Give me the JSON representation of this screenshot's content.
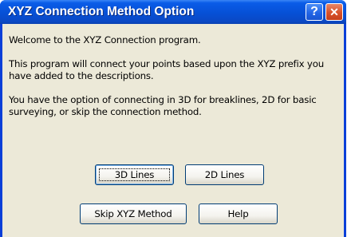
{
  "window": {
    "title": "XYZ Connection Method Option",
    "help_glyph": "?",
    "close_glyph": "✕"
  },
  "body": {
    "welcome": "Welcome to the XYZ Connection program.",
    "description": "This program will connect your points based upon the XYZ prefix you have added to the descriptions.",
    "options": "You have the option of connecting in 3D for breaklines, 2D for basic surveying, or skip the connection method."
  },
  "buttons": {
    "lines_3d": "3D Lines",
    "lines_2d": "2D Lines",
    "skip": "Skip XYZ Method",
    "help": "Help"
  },
  "colors": {
    "titlebar": "#0650d6",
    "client": "#ece9d8",
    "button_border": "#003c74",
    "close_button": "#d8512a"
  }
}
